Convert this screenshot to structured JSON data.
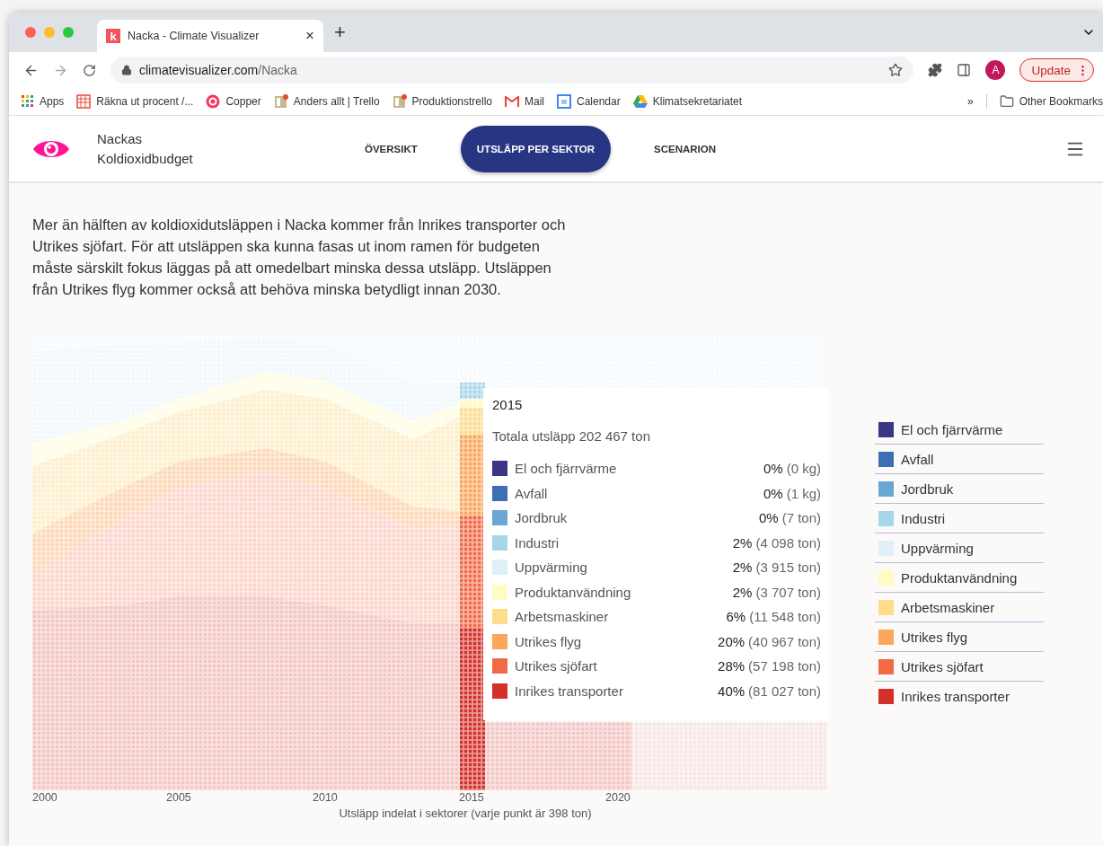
{
  "browser": {
    "favicon_letter": "k",
    "tab_title": "Nacka - Climate Visualizer",
    "tab_close": "×",
    "new_tab": "+",
    "address_host": "climatevisualizer.com",
    "address_path": "/Nacka",
    "profile": "A",
    "update": "Update",
    "bookmarks": [
      {
        "label": "Apps",
        "kind": "apps"
      },
      {
        "label": "Räkna ut procent /...",
        "kind": "calc"
      },
      {
        "label": "Copper",
        "kind": "copper"
      },
      {
        "label": "Anders allt | Trello",
        "kind": "trello"
      },
      {
        "label": "Produktionstrello",
        "kind": "trello"
      },
      {
        "label": "Mail",
        "kind": "mail"
      },
      {
        "label": "Calendar",
        "kind": "calendar"
      },
      {
        "label": "Klimatsekretariatet",
        "kind": "drive"
      }
    ],
    "more_bookmarks": "»",
    "other_bookmarks": "Other Bookmarks"
  },
  "site": {
    "brand": [
      "Nackas",
      "Koldioxidbudget"
    ],
    "nav": [
      {
        "label": "ÖVERSIKT",
        "selected": false
      },
      {
        "label": "UTSLÄPP PER SEKTOR",
        "selected": true
      },
      {
        "label": "SCENARION",
        "selected": false
      }
    ]
  },
  "intro": "Mer än hälften av koldioxidutsläppen i Nacka kommer från Inrikes transporter och Utrikes sjöfart. För att utsläppen ska kunna fasas ut inom ramen för budgeten måste särskilt fokus läggas på att omedelbart minska dessa utsläpp. Utsläppen från Utrikes flyg kommer också att behöva minska betydligt innan 2030.",
  "chart": {
    "x_ticks": [
      "2000",
      "2005",
      "2010",
      "2015",
      "2020"
    ],
    "x_label": "Utsläpp indelat i sektorer (varje punkt är 398 ton)",
    "tooltip": {
      "year": "2015",
      "total": "Totala utsläpp 202 467 ton",
      "rows": [
        {
          "name": "El och fjärrvärme",
          "color": "#3b3586",
          "percent": "0%",
          "amount": "(0 kg)"
        },
        {
          "name": "Avfall",
          "color": "#3e6fb5",
          "percent": "0%",
          "amount": "(1 kg)"
        },
        {
          "name": "Jordbruk",
          "color": "#6aa6d3",
          "percent": "0%",
          "amount": "(7 ton)"
        },
        {
          "name": "Industri",
          "color": "#a6d6ea",
          "percent": "2%",
          "amount": "(4 098 ton)"
        },
        {
          "name": "Uppvärming",
          "color": "#dff0f8",
          "percent": "2%",
          "amount": "(3 915 ton)"
        },
        {
          "name": "Produktanvändning",
          "color": "#fffbc4",
          "percent": "2%",
          "amount": "(3 707 ton)"
        },
        {
          "name": "Arbetsmaskiner",
          "color": "#fddc8c",
          "percent": "6%",
          "amount": "(11 548 ton)"
        },
        {
          "name": "Utrikes flyg",
          "color": "#fba65a",
          "percent": "20%",
          "amount": "(40 967 ton)"
        },
        {
          "name": "Utrikes sjöfart",
          "color": "#f26a45",
          "percent": "28%",
          "amount": "(57 198 ton)"
        },
        {
          "name": "Inrikes transporter",
          "color": "#d3302a",
          "percent": "40%",
          "amount": "(81 027 ton)"
        }
      ]
    }
  },
  "legend": [
    {
      "name": "El och fjärrvärme",
      "color": "#3b3586"
    },
    {
      "name": "Avfall",
      "color": "#3e6fb5"
    },
    {
      "name": "Jordbruk",
      "color": "#6aa6d3"
    },
    {
      "name": "Industri",
      "color": "#a6d6ea"
    },
    {
      "name": "Uppvärming",
      "color": "#dff0f8"
    },
    {
      "name": "Produktanvändning",
      "color": "#fffbc4"
    },
    {
      "name": "Arbetsmaskiner",
      "color": "#fddc8c"
    },
    {
      "name": "Utrikes flyg",
      "color": "#fba65a"
    },
    {
      "name": "Utrikes sjöfart",
      "color": "#f26a45"
    },
    {
      "name": "Inrikes transporter",
      "color": "#d3302a"
    }
  ]
}
